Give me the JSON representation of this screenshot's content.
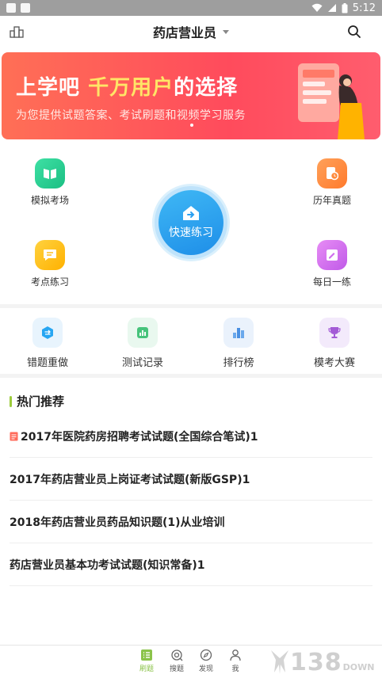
{
  "status_bar": {
    "time": "5:12"
  },
  "header": {
    "title": "药店营业员"
  },
  "banner": {
    "title_part1": "上学吧 ",
    "title_highlight": "千万用户",
    "title_part2": "的选择",
    "subtitle": "为您提供试题答案、考试刷题和视频学习服务"
  },
  "practice_grid": {
    "mock_exam": "模拟考场",
    "past_papers": "历年真题",
    "quick_practice": "快速练习",
    "key_points": "考点练习",
    "daily_practice": "每日一练"
  },
  "tools": [
    {
      "label": "错题重做",
      "icon": "redo-icon",
      "color": "#27a6f2"
    },
    {
      "label": "测试记录",
      "icon": "record-icon",
      "color": "#46c37b"
    },
    {
      "label": "排行榜",
      "icon": "ranking-icon",
      "color": "#4a90e2"
    },
    {
      "label": "模考大赛",
      "icon": "trophy-icon",
      "color": "#a35ad6"
    }
  ],
  "hot": {
    "title": "热门推荐",
    "items": [
      "2017年医院药房招聘考试试题(全国综合笔试)1",
      "2017年药店营业员上岗证考试试题(新版GSP)1",
      "2018年药店营业员药品知识题(1)从业培训",
      "药店营业员基本功考试试题(知识常备)1"
    ]
  },
  "tabbar": {
    "items": [
      {
        "label": "刷题",
        "icon": "practice-icon",
        "active": true
      },
      {
        "label": "搜题",
        "icon": "search-question-icon",
        "active": false
      },
      {
        "label": "发现",
        "icon": "compass-icon",
        "active": false
      },
      {
        "label": "我",
        "icon": "user-icon",
        "active": false
      }
    ]
  },
  "watermark": {
    "big": "138",
    "small": "DOWN"
  }
}
